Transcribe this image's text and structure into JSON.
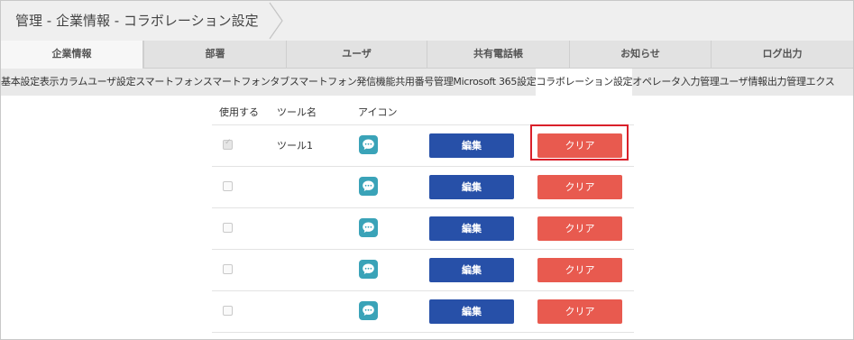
{
  "breadcrumb": {
    "text": "管理 - 企業情報 - コラボレーション設定"
  },
  "main_tabs": [
    {
      "label": "企業情報",
      "active": true
    },
    {
      "label": "部署"
    },
    {
      "label": "ユーザ"
    },
    {
      "label": "共有電話帳"
    },
    {
      "label": "お知らせ"
    },
    {
      "label": "ログ出力"
    }
  ],
  "sub_tabs": [
    {
      "label": "基本設定"
    },
    {
      "label": "表示カラム"
    },
    {
      "label": "ユーザ設定"
    },
    {
      "label": "スマートフォン"
    },
    {
      "label": "スマートフォンタブ"
    },
    {
      "label": "スマートフォン発信機能"
    },
    {
      "label": "共用番号管理"
    },
    {
      "label": "Microsoft 365設定"
    },
    {
      "label": "コラボレーション設定",
      "active": true
    },
    {
      "label": "オペレータ入力管理"
    },
    {
      "label": "ユーザ情報出力管理"
    },
    {
      "label": "エクス"
    }
  ],
  "table": {
    "headers": {
      "use": "使用する",
      "tool_name": "ツール名",
      "icon": "アイコン"
    },
    "rows": [
      {
        "checked": true,
        "disabled": true,
        "name": "ツール1",
        "edit_label": "編集",
        "clear_label": "クリア"
      },
      {
        "checked": false,
        "name": "",
        "edit_label": "編集",
        "clear_label": "クリア"
      },
      {
        "checked": false,
        "name": "",
        "edit_label": "編集",
        "clear_label": "クリア"
      },
      {
        "checked": false,
        "name": "",
        "edit_label": "編集",
        "clear_label": "クリア"
      },
      {
        "checked": false,
        "name": "",
        "edit_label": "編集",
        "clear_label": "クリア"
      }
    ]
  },
  "icon": {
    "name": "chat-bubble-icon",
    "color": "#3aa3b8"
  },
  "colors": {
    "edit": "#2750a8",
    "clear": "#e85a4f",
    "highlight": "#d9202a"
  }
}
